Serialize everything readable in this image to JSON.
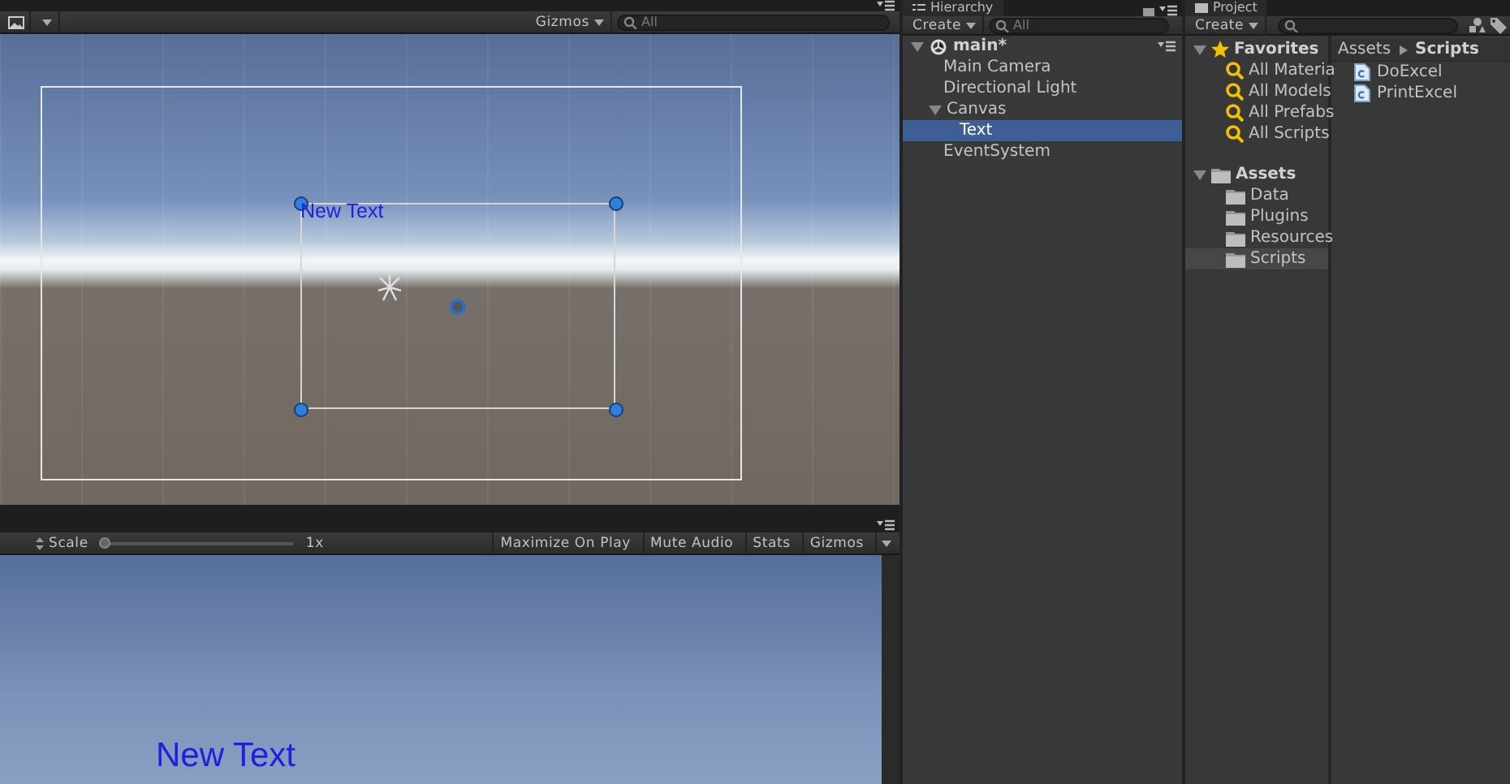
{
  "scene_view": {
    "toolbar": {
      "gizmos": "Gizmos",
      "search_placeholder": "All"
    },
    "ui_text": "New Text"
  },
  "game_view": {
    "toolbar": {
      "scale_label": "Scale",
      "scale": {
        "level": 0
      },
      "scale_reading": "1x",
      "buttons": [
        {
          "label": "Maximize On Play",
          "on": false
        },
        {
          "label": "Mute Audio",
          "on": false
        },
        {
          "label": "Stats",
          "on": false
        },
        {
          "label": "Gizmos",
          "on": false
        }
      ]
    },
    "ui_text": "New Text"
  },
  "hierarchy": {
    "title": "Hierarchy",
    "create": "Create",
    "search_placeholder": "All",
    "scene": {
      "name": "main*",
      "expanded": true
    },
    "items": [
      {
        "label": "Main Camera",
        "selected": false
      },
      {
        "label": "Directional Light",
        "selected": false
      },
      {
        "label": "Canvas",
        "selected": false,
        "expanded": true,
        "children": [
          {
            "label": "Text",
            "selected": true
          }
        ]
      },
      {
        "label": "EventSystem",
        "selected": false
      }
    ]
  },
  "project": {
    "title": "Project",
    "create": "Create",
    "favorites": {
      "label": "Favorites",
      "expanded": true,
      "items": [
        "All Materia",
        "All Models",
        "All Prefabs",
        "All Scripts"
      ]
    },
    "assets": {
      "label": "Assets",
      "expanded": true,
      "children": [
        {
          "label": "Data",
          "selected": false
        },
        {
          "label": "Plugins",
          "selected": false
        },
        {
          "label": "Resources",
          "selected": false
        },
        {
          "label": "Scripts",
          "selected": true
        }
      ]
    },
    "breadcrumb": [
      "Assets",
      "Scripts"
    ],
    "files": [
      "DoExcel",
      "PrintExcel"
    ]
  }
}
